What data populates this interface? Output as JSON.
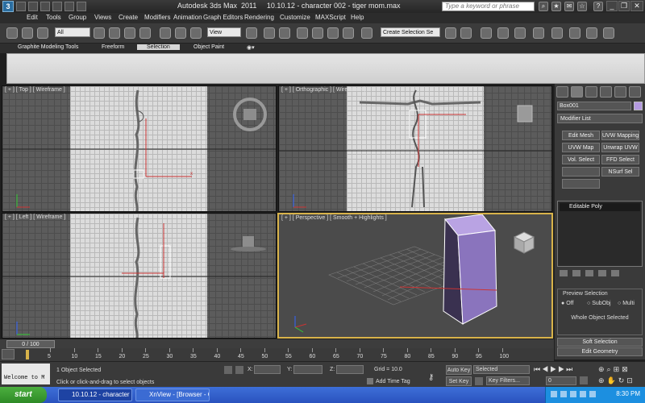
{
  "window": {
    "title": "Autodesk 3ds Max  2011     10.10.12 - character 002 - tiger mom.max",
    "search_placeholder": "Type a keyword or phrase"
  },
  "menu": [
    "Edit",
    "Tools",
    "Group",
    "Views",
    "Create",
    "Modifiers",
    "Animation",
    "Graph Editors",
    "Rendering",
    "Customize",
    "MAXScript",
    "Help"
  ],
  "toolbar": {
    "selection_filter": "All",
    "ref_coord": "View",
    "named_selection": "Create Selection Se",
    "angle_snap": "3"
  },
  "ribbon": {
    "tabs": [
      "Graphite Modeling Tools",
      "Freeform",
      "Selection",
      "Object Paint"
    ],
    "active_tab": "Selection"
  },
  "viewports": {
    "top": "[ + ] [ Top ] [ Wireframe ]",
    "front": "[ + ] [ Orthographic ] [ Wireframe ]",
    "left": "[ + ] [ Left ] [ Wireframe ]",
    "persp": "[ + ] [ Perspective ] [ Smooth + Highlights ]"
  },
  "command_panel": {
    "object_name": "Box001",
    "modifier_list": "Modifier List",
    "buttons": [
      "Edit Mesh",
      "UVW Mapping Ad",
      "UVW Map",
      "Unwrap UVW",
      "Vol. Select",
      "FFD Select",
      "",
      "NSurf Sel"
    ],
    "stack_item": "Editable Poly",
    "preview_selection": "Preview Selection",
    "preview_options": [
      "Off",
      "SubObj",
      "Multi"
    ],
    "whole_object": "Whole Object Selected",
    "soft_selection": "Soft Selection",
    "edit_geometry": "Edit Geometry"
  },
  "timeline": {
    "frame": "0 / 100",
    "ticks": [
      "5",
      "10",
      "15",
      "20",
      "25",
      "30",
      "35",
      "40",
      "45",
      "50",
      "55",
      "60",
      "65",
      "70",
      "75",
      "80",
      "85",
      "90",
      "95",
      "100"
    ]
  },
  "status": {
    "welcome": "Welcome to M",
    "selected": "1 Object Selected",
    "prompt": "Click or click-and-drag to select objects",
    "x_label": "X:",
    "y_label": "Y:",
    "z_label": "Z:",
    "grid": "Grid = 10.0",
    "add_time_tag": "Add Time Tag",
    "auto_key": "Auto Key",
    "set_key": "Set Key",
    "key_mode": "Selected",
    "key_filters": "Key Filters...",
    "frame_field": "0"
  },
  "taskbar": {
    "start": "start",
    "tasks": [
      "10.10.12 - character ...",
      "XnView - [Browser - C..."
    ],
    "clock": "8:30 PM"
  },
  "colors": {
    "object_color": "#b49ae0",
    "box_face": "#9f86c9",
    "active_viewport_border": "#d8b34a"
  }
}
